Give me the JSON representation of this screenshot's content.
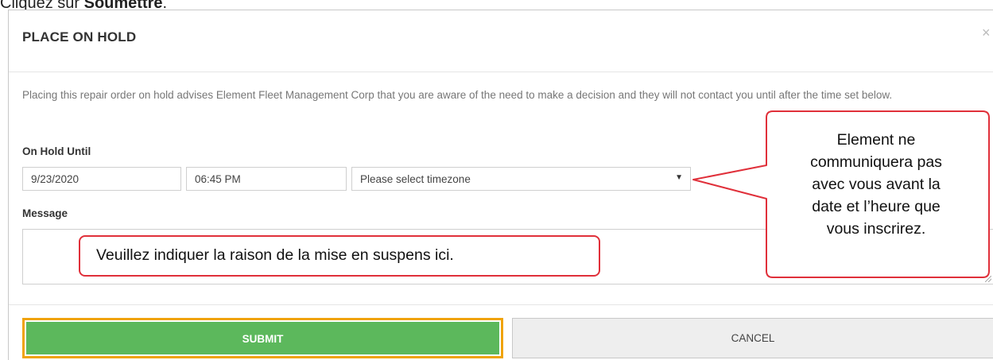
{
  "caption": {
    "prefix": "Cliquez sur ",
    "bold": "Soumettre",
    "suffix": "."
  },
  "modal": {
    "title": "PLACE ON HOLD",
    "close_icon": "×",
    "description": "Placing this repair order on hold advises Element Fleet Management Corp that you are aware of the need to make a decision and they will not contact you until after the time set below.",
    "on_hold_label": "On Hold Until",
    "date_value": "9/23/2020",
    "time_value": "06:45 PM",
    "timezone_value": "Please select timezone",
    "timezone_arrow": "▼",
    "message_label": "Message",
    "message_value": "",
    "submit_label": "SUBMIT",
    "cancel_label": "CANCEL"
  },
  "annotations": {
    "reason": "Veuillez indiquer la raison de la mise en suspens ici.",
    "element_lines": [
      "Element ne",
      "communiquera pas",
      "avec vous avant la",
      "date et l’heure que",
      "vous inscrirez."
    ]
  },
  "colors": {
    "submit_bg": "#5cb85c",
    "highlight_border": "#f0a30a",
    "annotation_border": "#e0303a"
  }
}
